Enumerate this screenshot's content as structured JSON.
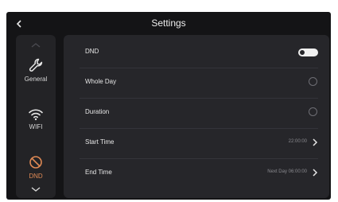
{
  "header": {
    "title": "Settings",
    "back_icon": "chevron-left-icon"
  },
  "sidebar": {
    "scroll_up_icon": "chevron-up-icon",
    "scroll_down_icon": "chevron-down-icon",
    "items": [
      {
        "label": "General",
        "icon": "wrench-icon",
        "active": false
      },
      {
        "label": "WIFI",
        "icon": "wifi-icon",
        "active": false
      },
      {
        "label": "DND",
        "icon": "do-not-disturb-icon",
        "active": true
      }
    ],
    "active_color": "#e08a55"
  },
  "settings": {
    "rows": [
      {
        "label": "DND",
        "control": "toggle",
        "state": "off"
      },
      {
        "label": "Whole Day",
        "control": "radio",
        "checked": false
      },
      {
        "label": "Duration",
        "control": "radio",
        "checked": false
      },
      {
        "label": "Start Time",
        "control": "value",
        "value": "22:00:00"
      },
      {
        "label": "End Time",
        "control": "value",
        "value": "Next Day 06:00:00"
      }
    ]
  },
  "colors": {
    "background": "#141416",
    "panel": "#26262a",
    "sidebar": "#232326",
    "text": "#e6e6e6",
    "muted": "#8a8a8f"
  }
}
